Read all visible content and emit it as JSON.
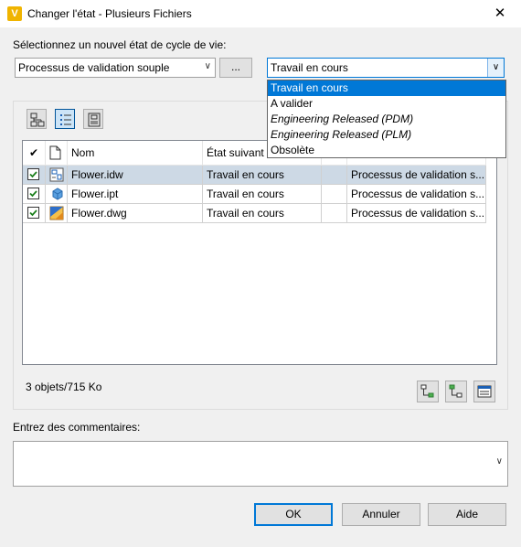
{
  "window": {
    "app_icon_letter": "V",
    "title": "Changer l'état - Plusieurs Fichiers",
    "close_glyph": "✕"
  },
  "lifecycle": {
    "label": "Sélectionnez un nouvel état de cycle de vie:",
    "process_value": "Processus de validation souple",
    "browse_label": "...",
    "state_value": "Travail en cours",
    "state_options": [
      {
        "label": "Travail en cours",
        "selected": true,
        "italic": false
      },
      {
        "label": "A valider",
        "selected": false,
        "italic": false
      },
      {
        "label": "Engineering Released (PDM)",
        "selected": false,
        "italic": true
      },
      {
        "label": "Engineering Released (PLM)",
        "selected": false,
        "italic": true
      },
      {
        "label": "Obsolète",
        "selected": false,
        "italic": false
      }
    ]
  },
  "view_toolbar": {
    "buttons": [
      {
        "icon": "tree-view-icon",
        "active": false
      },
      {
        "icon": "list-view-icon",
        "active": true
      },
      {
        "icon": "grid-view-icon",
        "active": false
      }
    ]
  },
  "grid": {
    "headers": {
      "check": "✔",
      "name": "Nom",
      "next_state": "État suivant",
      "extra": "",
      "process": ""
    },
    "rows": [
      {
        "checked": true,
        "icon": "idw-file-icon",
        "name": "Flower.idw",
        "next_state": "Travail en cours",
        "extra": "",
        "process": "Processus de validation s...",
        "selected": true
      },
      {
        "checked": true,
        "icon": "ipt-file-icon",
        "name": "Flower.ipt",
        "next_state": "Travail en cours",
        "extra": "",
        "process": "Processus de validation s...",
        "selected": false
      },
      {
        "checked": true,
        "icon": "dwg-file-icon",
        "name": "Flower.dwg",
        "next_state": "Travail en cours",
        "extra": "",
        "process": "Processus de validation s...",
        "selected": false
      }
    ]
  },
  "status": {
    "count": "3 objets/715 Ko"
  },
  "bottom_tools": [
    {
      "icon": "expand-tree-icon"
    },
    {
      "icon": "collapse-tree-icon"
    },
    {
      "icon": "columns-icon"
    }
  ],
  "comments": {
    "label": "Entrez des commentaires:",
    "value": ""
  },
  "buttons": {
    "ok": "OK",
    "cancel": "Annuler",
    "help": "Aide"
  },
  "colors": {
    "selection": "#0078d7",
    "selected_row": "#cdd9e5",
    "dialog_bg": "#f0f0f0"
  }
}
